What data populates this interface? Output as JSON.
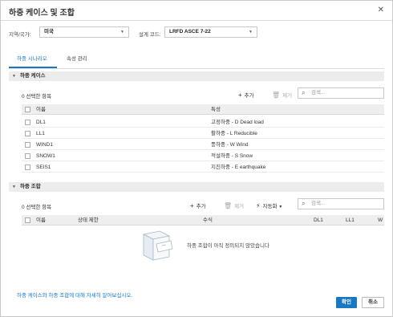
{
  "dialog": {
    "title": "하중 케이스 및 조합",
    "close_symbol": "✕"
  },
  "region": {
    "label": "지역/국가:",
    "value": "미국"
  },
  "design_code": {
    "label": "설계 코드:",
    "value": "LRFD ASCE 7-22"
  },
  "tabs": [
    {
      "label": "하중 시나리오",
      "active": true
    },
    {
      "label": "속성 관리",
      "active": false
    }
  ],
  "load_cases": {
    "header": "하중 케이스",
    "selected_count": "0 선택한 항목",
    "add_label": "추가",
    "delete_label": "제거",
    "search_placeholder": "검색...",
    "columns": [
      "이름",
      "특성"
    ],
    "rows": [
      {
        "name": "DL1",
        "property": "고정하중 - D Dead load"
      },
      {
        "name": "LL1",
        "property": "활하중 - L Reducible"
      },
      {
        "name": "WIND1",
        "property": "풍하중 - W Wind"
      },
      {
        "name": "SNOW1",
        "property": "적설하중 - S Snow"
      },
      {
        "name": "SEIS1",
        "property": "지진하중 - E earthquake"
      }
    ]
  },
  "load_combos": {
    "header": "하중 조합",
    "selected_count": "0 선택한 항목",
    "add_label": "추가",
    "delete_label": "제거",
    "auto_label": "자동화",
    "search_placeholder": "검색...",
    "columns": [
      "이름",
      "상태 제한",
      "수식",
      "DL1",
      "LL1",
      "W"
    ],
    "empty_message": "하중 조합이 아직 정의되지 않았습니다"
  },
  "footer": {
    "help_link": "하중 케이스와 하중 조합에 대해 자세히 알아보십시오.",
    "ok_label": "확인",
    "cancel_label": "취소"
  },
  "colors": {
    "accent": "#1a78c2",
    "section_bg": "#ececec"
  }
}
